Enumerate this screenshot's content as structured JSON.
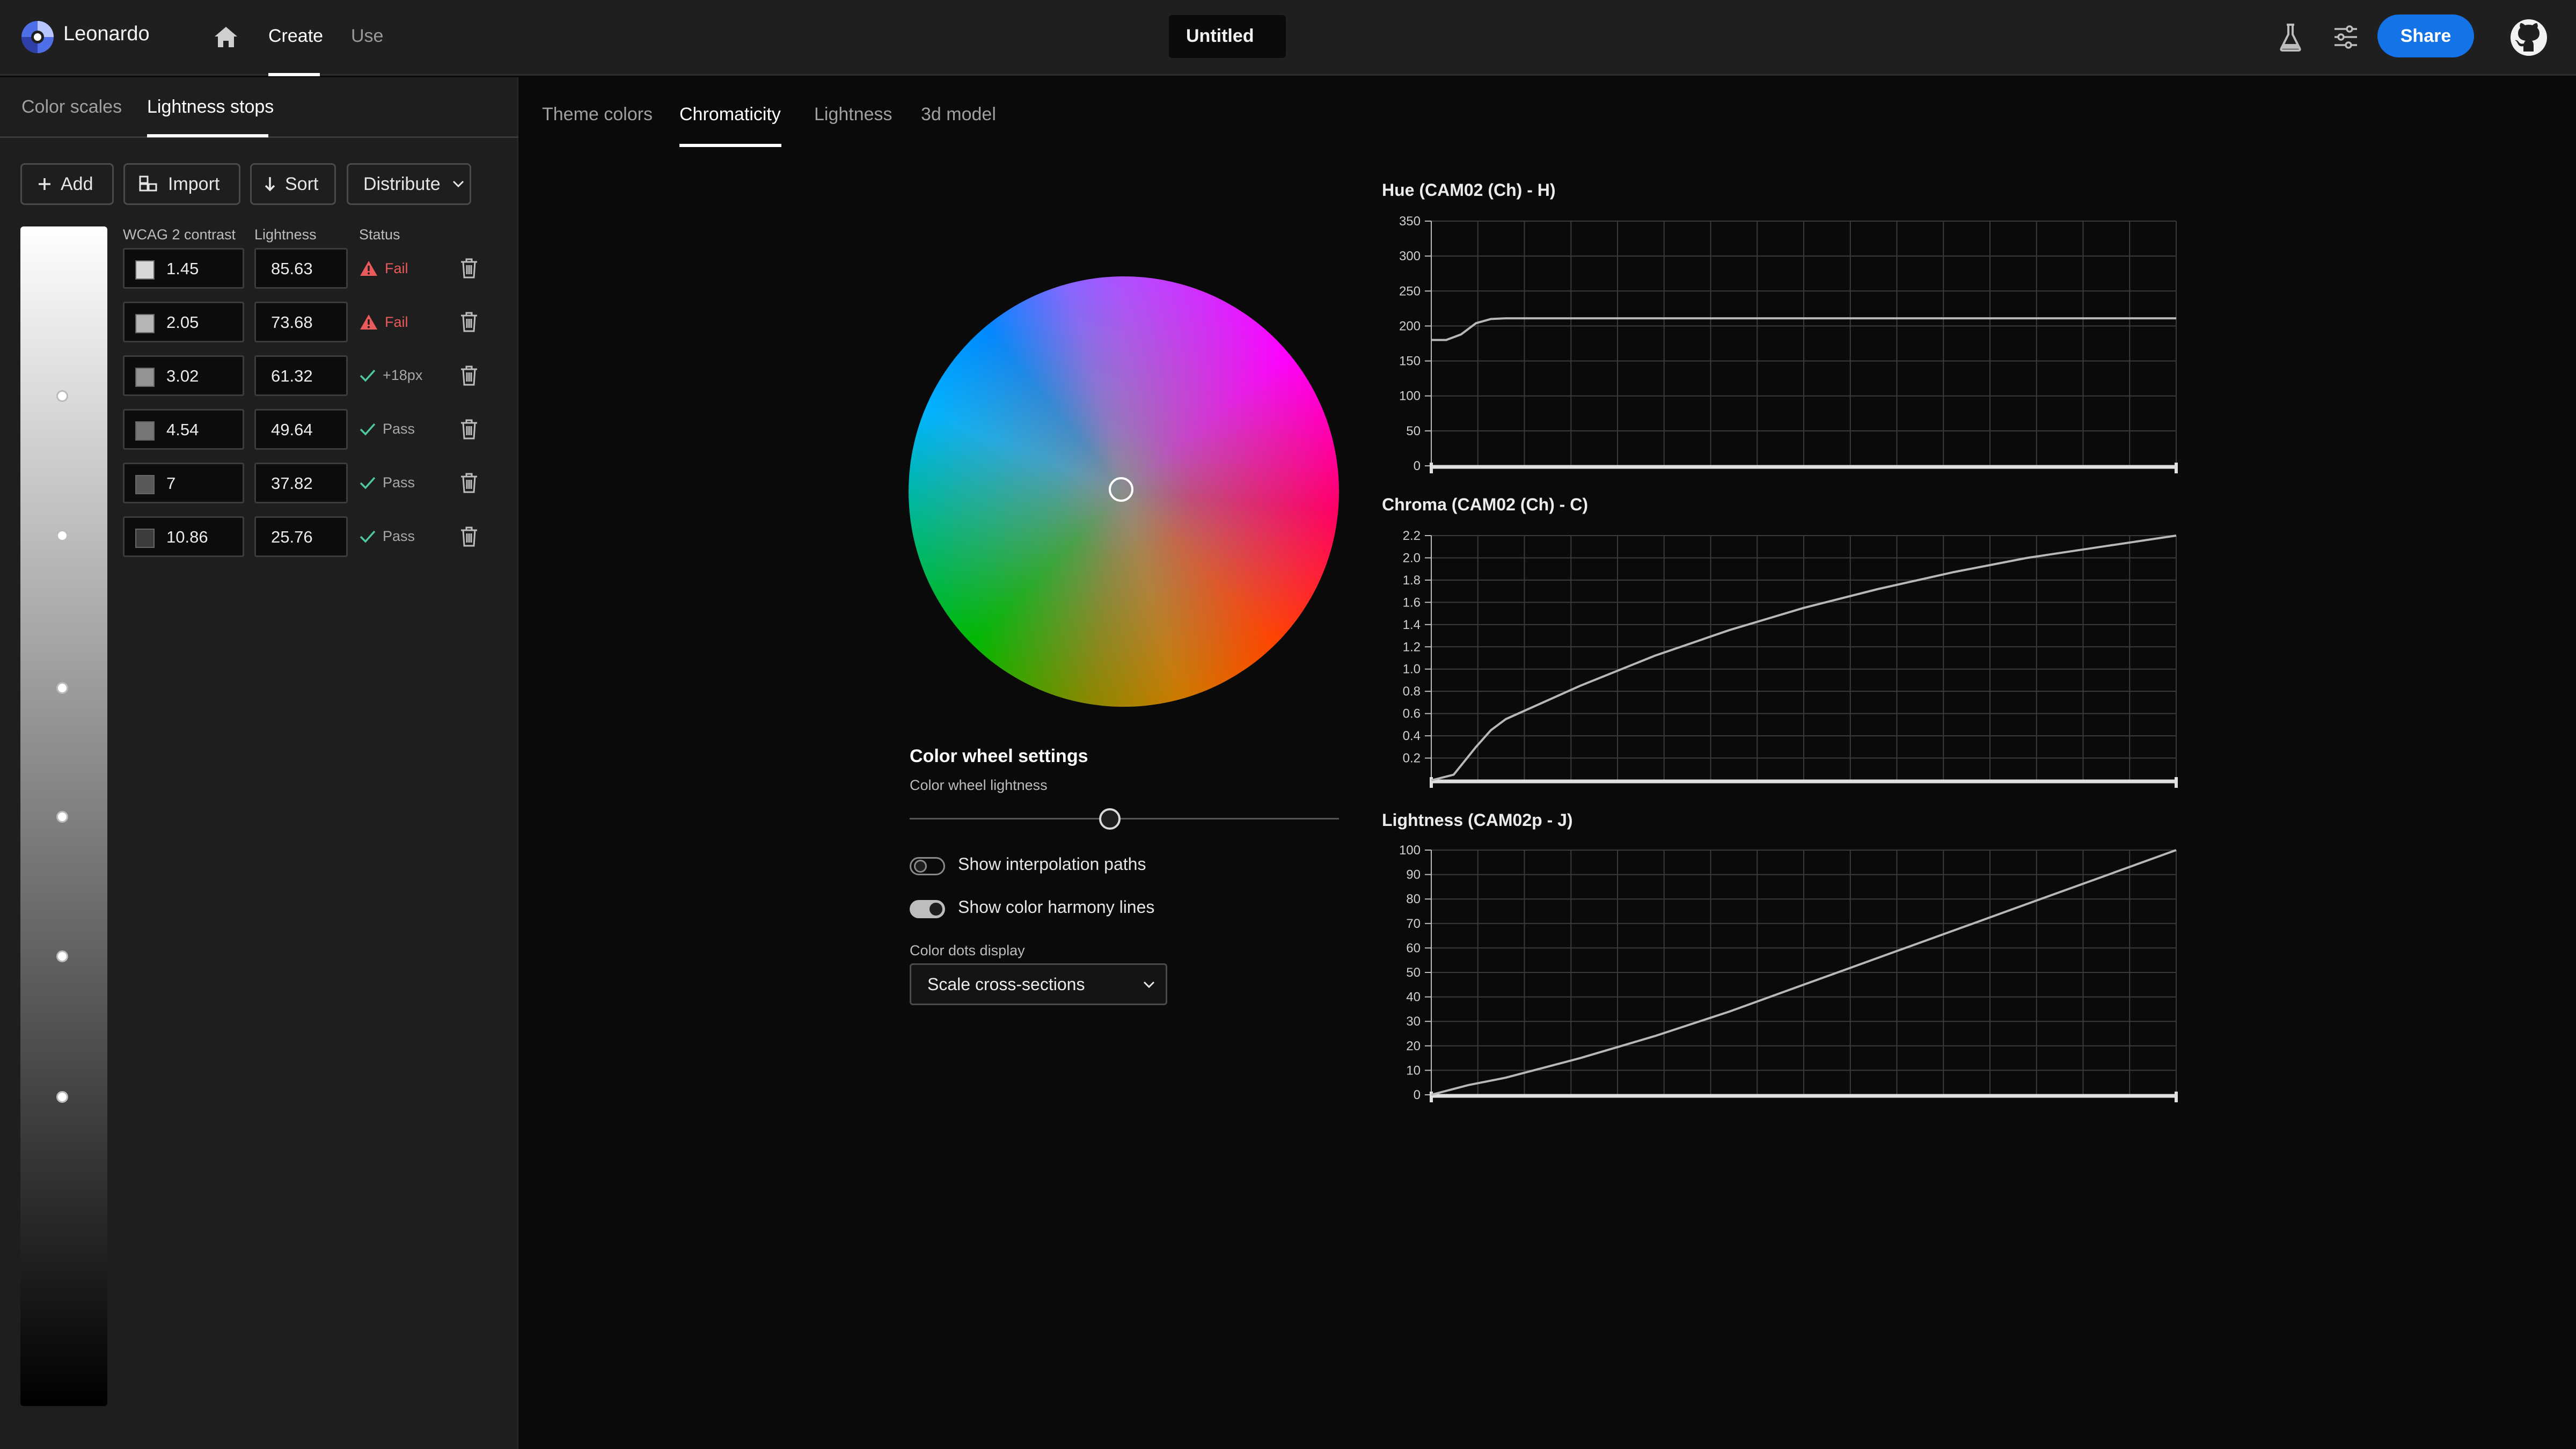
{
  "header": {
    "app_name": "Leonardo",
    "nav": [
      "Create",
      "Use"
    ],
    "document_title": "Untitled",
    "share_label": "Share",
    "accent_color": "#1473e6"
  },
  "left_panel": {
    "tabs": [
      "Color scales",
      "Lightness stops"
    ],
    "active_tab": "Lightness stops",
    "toolbar": {
      "add_label": "Add",
      "import_label": "Import",
      "sort_label": "Sort",
      "distribute_label": "Distribute"
    },
    "columns": [
      "WCAG 2 contrast",
      "Lightness",
      "Status"
    ],
    "stops": [
      {
        "contrast": "1.45",
        "lightness": "85.63",
        "status": "Fail",
        "swatch": "#d8d8d8"
      },
      {
        "contrast": "2.05",
        "lightness": "73.68",
        "status": "Fail",
        "swatch": "#b5b5b5"
      },
      {
        "contrast": "3.02",
        "lightness": "61.32",
        "status": "+18px",
        "swatch": "#939393"
      },
      {
        "contrast": "4.54",
        "lightness": "49.64",
        "status": "Pass",
        "swatch": "#767676"
      },
      {
        "contrast": "7",
        "lightness": "37.82",
        "status": "Pass",
        "swatch": "#595959"
      },
      {
        "contrast": "10.86",
        "lightness": "25.76",
        "status": "Pass",
        "swatch": "#3c3c3c"
      }
    ],
    "status_colors": {
      "fail": "#ea5a5a",
      "pass": "#4ec9a0"
    }
  },
  "main": {
    "tabs": [
      "Theme colors",
      "Chromaticity",
      "Lightness",
      "3d model"
    ],
    "active_tab": "Chromaticity",
    "wheel_settings": {
      "title": "Color wheel settings",
      "lightness_label": "Color wheel lightness",
      "lightness_value": 0.6,
      "toggles": [
        {
          "label": "Show interpolation paths",
          "on": false
        },
        {
          "label": "Show color harmony lines",
          "on": true
        }
      ],
      "dots_display_label": "Color dots display",
      "dots_display_value": "Scale cross-sections"
    }
  },
  "chart_data": [
    {
      "type": "line",
      "title": "Hue (CAM02 (Ch) - H)",
      "ylim": [
        0,
        350
      ],
      "yticks": [
        0,
        50,
        100,
        150,
        200,
        250,
        300,
        350
      ],
      "xlim": [
        0,
        1
      ],
      "x": [
        0,
        0.02,
        0.04,
        0.06,
        0.08,
        0.1,
        1.0
      ],
      "y": [
        180,
        180,
        188,
        204,
        210,
        211,
        211
      ],
      "grid": true
    },
    {
      "type": "line",
      "title": "Chroma (CAM02 (Ch) - C)",
      "ylim": [
        0,
        2.2
      ],
      "yticks": [
        0.2,
        0.4,
        0.6,
        0.8,
        1.0,
        1.2,
        1.4,
        1.6,
        1.8,
        2.0,
        2.2
      ],
      "xlim": [
        0,
        1
      ],
      "x": [
        0,
        0.03,
        0.06,
        0.08,
        0.1,
        0.2,
        0.3,
        0.4,
        0.5,
        0.6,
        0.7,
        0.8,
        0.9,
        1.0
      ],
      "y": [
        0.0,
        0.05,
        0.3,
        0.45,
        0.55,
        0.85,
        1.12,
        1.35,
        1.55,
        1.72,
        1.87,
        2.0,
        2.1,
        2.2
      ],
      "grid": true
    },
    {
      "type": "line",
      "title": "Lightness (CAM02p - J)",
      "ylim": [
        0,
        100
      ],
      "yticks": [
        0,
        10,
        20,
        30,
        40,
        50,
        60,
        70,
        80,
        90,
        100
      ],
      "xlim": [
        0,
        1
      ],
      "x": [
        0,
        0.05,
        0.1,
        0.2,
        0.3,
        0.4,
        0.5,
        0.6,
        0.7,
        0.8,
        0.9,
        1.0
      ],
      "y": [
        0,
        4,
        7,
        15,
        24,
        34,
        45,
        56,
        67,
        78,
        89,
        100
      ],
      "grid": true
    }
  ]
}
